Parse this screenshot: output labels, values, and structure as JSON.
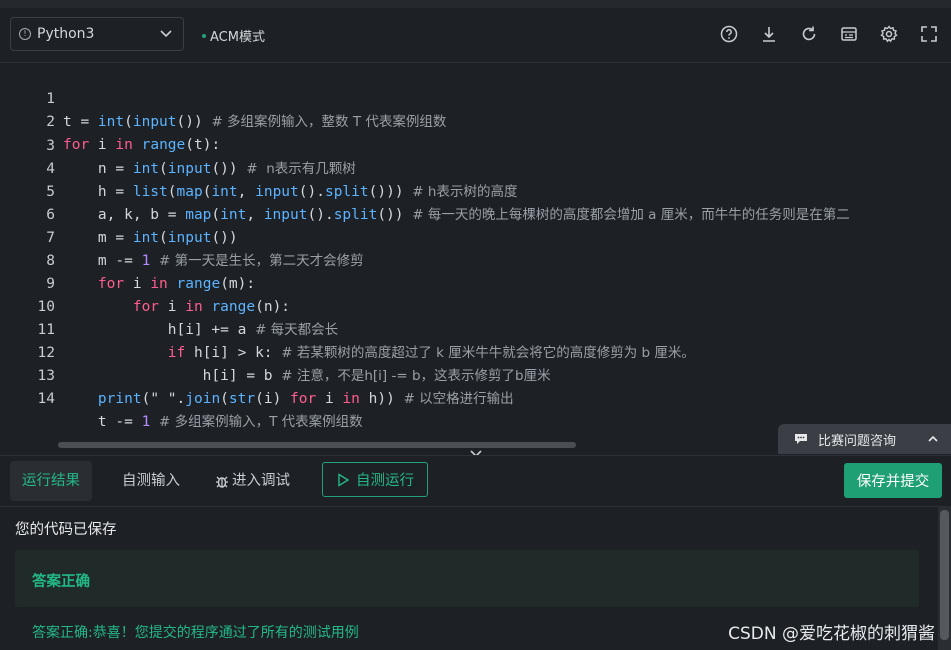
{
  "toolbar": {
    "language": "Python3",
    "mode": "ACM模式",
    "icons": [
      "help-icon",
      "download-icon",
      "refresh-icon",
      "keyboard-icon",
      "gear-icon",
      "fullscreen-icon"
    ]
  },
  "editor": {
    "line_numbers": [
      "1",
      "2",
      "3",
      "4",
      "5",
      "6",
      "7",
      "8",
      "9",
      "10",
      "11",
      "12",
      "13",
      "14"
    ]
  },
  "consult": {
    "label": "比赛问题咨询"
  },
  "bottom": {
    "tab_result": "运行结果",
    "tab_input": "自测输入",
    "tab_debug": "进入调试",
    "run_label": "自测运行",
    "submit_label": "保存并提交"
  },
  "result": {
    "saved": "您的代码已保存",
    "status": "答案正确",
    "detail": "答案正确:恭喜！您提交的程序通过了所有的测试用例"
  },
  "watermark": "CSDN @爱吃花椒的刺猬酱",
  "colors": {
    "accent": "#23b987",
    "keyword": "#ff5e8e",
    "function": "#5cb3ff",
    "number": "#b48cff"
  }
}
